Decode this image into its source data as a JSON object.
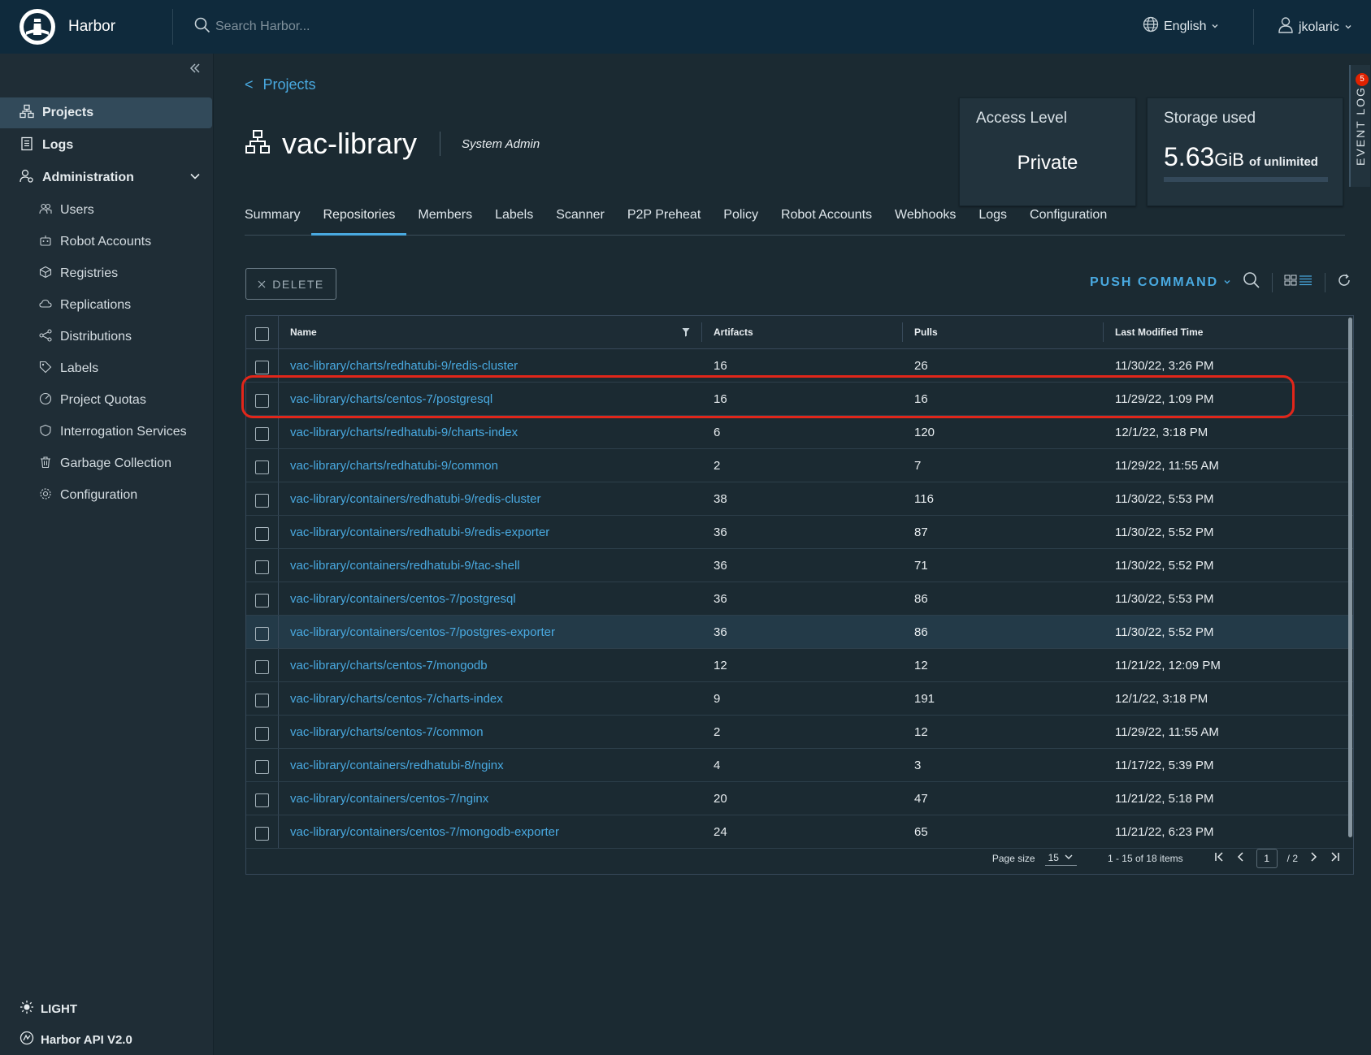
{
  "header": {
    "brand": "Harbor",
    "search_placeholder": "Search Harbor...",
    "language": "English",
    "user": "jkolaric"
  },
  "sidebar": {
    "items": [
      {
        "label": "Projects",
        "icon": "projects-icon"
      },
      {
        "label": "Logs",
        "icon": "logs-icon"
      },
      {
        "label": "Administration",
        "icon": "administration-icon"
      }
    ],
    "admin_items": [
      {
        "label": "Users",
        "icon": "users-icon"
      },
      {
        "label": "Robot Accounts",
        "icon": "robot-icon"
      },
      {
        "label": "Registries",
        "icon": "registries-icon"
      },
      {
        "label": "Replications",
        "icon": "replications-icon"
      },
      {
        "label": "Distributions",
        "icon": "distributions-icon"
      },
      {
        "label": "Labels",
        "icon": "labels-icon"
      },
      {
        "label": "Project Quotas",
        "icon": "quotas-icon"
      },
      {
        "label": "Interrogation Services",
        "icon": "shield-icon"
      },
      {
        "label": "Garbage Collection",
        "icon": "trash-icon"
      },
      {
        "label": "Configuration",
        "icon": "gear-icon"
      }
    ],
    "theme": "LIGHT",
    "api": "Harbor API V2.0"
  },
  "project": {
    "breadcrumb": "Projects",
    "name": "vac-library",
    "role": "System Admin",
    "access_label": "Access Level",
    "access_value": "Private",
    "storage_label": "Storage used",
    "storage_value": "5.63",
    "storage_unit": "GiB",
    "storage_of": "of unlimited",
    "event_log": "EVENT LOG",
    "event_count": "5"
  },
  "tabs": [
    "Summary",
    "Repositories",
    "Members",
    "Labels",
    "Scanner",
    "P2P Preheat",
    "Policy",
    "Robot Accounts",
    "Webhooks",
    "Logs",
    "Configuration"
  ],
  "toolbar": {
    "delete_label": "DELETE",
    "push_command_label": "PUSH COMMAND"
  },
  "table": {
    "columns": [
      "Name",
      "Artifacts",
      "Pulls",
      "Last Modified Time"
    ],
    "rows": [
      {
        "name": "vac-library/charts/redhatubi-9/redis-cluster",
        "artifacts": "16",
        "pulls": "26",
        "time": "11/30/22, 3:26 PM"
      },
      {
        "name": "vac-library/charts/centos-7/postgresql",
        "artifacts": "16",
        "pulls": "16",
        "time": "11/29/22, 1:09 PM"
      },
      {
        "name": "vac-library/charts/redhatubi-9/charts-index",
        "artifacts": "6",
        "pulls": "120",
        "time": "12/1/22, 3:18 PM"
      },
      {
        "name": "vac-library/charts/redhatubi-9/common",
        "artifacts": "2",
        "pulls": "7",
        "time": "11/29/22, 11:55 AM"
      },
      {
        "name": "vac-library/containers/redhatubi-9/redis-cluster",
        "artifacts": "38",
        "pulls": "116",
        "time": "11/30/22, 5:53 PM"
      },
      {
        "name": "vac-library/containers/redhatubi-9/redis-exporter",
        "artifacts": "36",
        "pulls": "87",
        "time": "11/30/22, 5:52 PM"
      },
      {
        "name": "vac-library/containers/redhatubi-9/tac-shell",
        "artifacts": "36",
        "pulls": "71",
        "time": "11/30/22, 5:52 PM"
      },
      {
        "name": "vac-library/containers/centos-7/postgresql",
        "artifacts": "36",
        "pulls": "86",
        "time": "11/30/22, 5:53 PM"
      },
      {
        "name": "vac-library/containers/centos-7/postgres-exporter",
        "artifacts": "36",
        "pulls": "86",
        "time": "11/30/22, 5:52 PM"
      },
      {
        "name": "vac-library/charts/centos-7/mongodb",
        "artifacts": "12",
        "pulls": "12",
        "time": "11/21/22, 12:09 PM"
      },
      {
        "name": "vac-library/charts/centos-7/charts-index",
        "artifacts": "9",
        "pulls": "191",
        "time": "12/1/22, 3:18 PM"
      },
      {
        "name": "vac-library/charts/centos-7/common",
        "artifacts": "2",
        "pulls": "12",
        "time": "11/29/22, 11:55 AM"
      },
      {
        "name": "vac-library/containers/redhatubi-8/nginx",
        "artifacts": "4",
        "pulls": "3",
        "time": "11/17/22, 5:39 PM"
      },
      {
        "name": "vac-library/containers/centos-7/nginx",
        "artifacts": "20",
        "pulls": "47",
        "time": "11/21/22, 5:18 PM"
      },
      {
        "name": "vac-library/containers/centos-7/mongodb-exporter",
        "artifacts": "24",
        "pulls": "65",
        "time": "11/21/22, 6:23 PM"
      }
    ]
  },
  "pagination": {
    "page_size_label": "Page size",
    "page_size": "15",
    "range": "1 - 15 of 18 items",
    "current_page": "1",
    "total_pages": "/ 2"
  },
  "colors": {
    "accent": "#49a9e0",
    "highlight": "#e2261a",
    "header_bg": "#0f2a3c"
  }
}
